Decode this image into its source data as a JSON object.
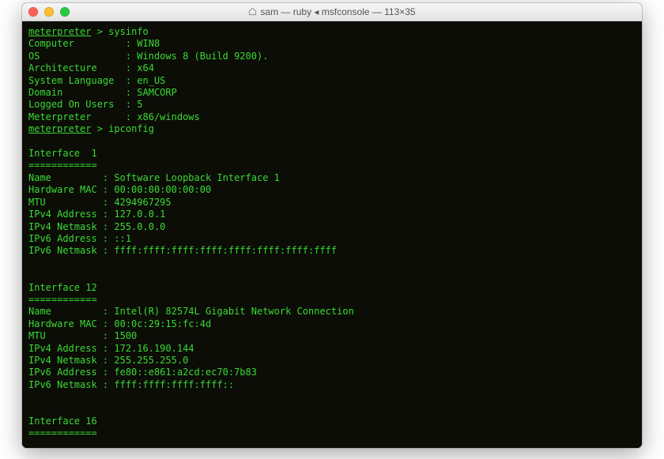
{
  "title": "sam — ruby ◂ msfconsole — 113×35",
  "prompt": "meterpreter",
  "sep": " > ",
  "cmd1": "sysinfo",
  "sys": {
    "computer": "Computer         : WIN8",
    "os": "OS               : Windows 8 (Build 9200).",
    "arch": "Architecture     : x64",
    "lang": "System Language  : en_US",
    "domain": "Domain           : SAMCORP",
    "users": "Logged On Users  : 5",
    "meterpreter": "Meterpreter      : x86/windows"
  },
  "cmd2": "ipconfig",
  "if1": {
    "hdr": "Interface  1",
    "sep": "============",
    "name": "Name         : Software Loopback Interface 1",
    "mac": "Hardware MAC : 00:00:00:00:00:00",
    "mtu": "MTU          : 4294967295",
    "v4a": "IPv4 Address : 127.0.0.1",
    "v4m": "IPv4 Netmask : 255.0.0.0",
    "v6a": "IPv6 Address : ::1",
    "v6m": "IPv6 Netmask : ffff:ffff:ffff:ffff:ffff:ffff:ffff:ffff"
  },
  "if12": {
    "hdr": "Interface 12",
    "sep": "============",
    "name": "Name         : Intel(R) 82574L Gigabit Network Connection",
    "mac": "Hardware MAC : 00:0c:29:15:fc:4d",
    "mtu": "MTU          : 1500",
    "v4a": "IPv4 Address : 172.16.190.144",
    "v4m": "IPv4 Netmask : 255.255.255.0",
    "v6a": "IPv6 Address : fe80::e861:a2cd:ec70:7b83",
    "v6m": "IPv6 Netmask : ffff:ffff:ffff:ffff::"
  },
  "if16": {
    "hdr": "Interface 16",
    "sep": "============"
  }
}
